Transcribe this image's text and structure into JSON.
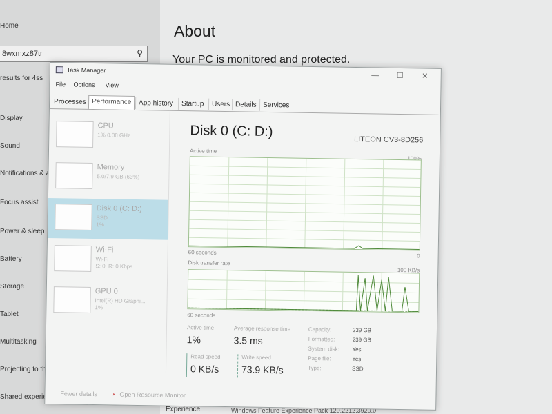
{
  "background": {
    "sidebar_items": [
      "Home",
      "Display",
      "Sound",
      "Notifications & actions",
      "Focus assist",
      "Power & sleep",
      "Battery",
      "Storage",
      "Tablet",
      "Multitasking",
      "Projecting to this PC",
      "Shared experiences"
    ],
    "search_value": "8wxmxz87tr",
    "results_text": "results for 4ss",
    "about_title": "About",
    "about_subtitle": "Your PC is monitored and protected.",
    "bottom_link": "Experience",
    "bottom_text": "Windows Feature Experience Pack 120.2212.3920.0"
  },
  "task_manager": {
    "title": "Task Manager",
    "window_buttons": [
      "—",
      "☐",
      "✕"
    ],
    "menu": [
      "File",
      "Options",
      "View"
    ],
    "tabs": [
      "Processes",
      "Performance",
      "App history",
      "Startup",
      "Users",
      "Details",
      "Services"
    ],
    "active_tab": "Performance",
    "resources": [
      {
        "name": "CPU",
        "detail": "1% 0.88 GHz"
      },
      {
        "name": "Memory",
        "detail": "5.0/7.9 GB (63%)"
      },
      {
        "name": "Disk 0 (C: D:)",
        "detail": "SSD\n1%"
      },
      {
        "name": "Wi-Fi",
        "detail": "Wi-Fi\nS: 0  R: 0 Kbps"
      },
      {
        "name": "GPU 0",
        "detail": "Intel(R) HD Graphi...\n1%"
      }
    ],
    "disk": {
      "title": "Disk 0 (C: D:)",
      "model": "LITEON CV3-8D256",
      "active_time_label": "Active time",
      "active_time_max": "100%",
      "seconds_label_1": "60 seconds",
      "seconds_label_1_end": "0",
      "transfer_label": "Disk transfer rate",
      "transfer_max": "100 KB/s",
      "seconds_label_2": "60 seconds",
      "stats": {
        "active_time": {
          "label": "Active time",
          "value": "1%"
        },
        "avg_response": {
          "label": "Average response time",
          "value": "3.5 ms"
        },
        "read_speed": {
          "label": "Read speed",
          "value": "0 KB/s"
        },
        "write_speed": {
          "label": "Write speed",
          "value": "73.9 KB/s"
        }
      },
      "properties": [
        {
          "label": "Capacity:",
          "value": "239 GB"
        },
        {
          "label": "Formatted:",
          "value": "239 GB"
        },
        {
          "label": "System disk:",
          "value": "Yes"
        },
        {
          "label": "Page file:",
          "value": "Yes"
        },
        {
          "label": "Type:",
          "value": "SSD"
        }
      ]
    },
    "footer": {
      "fewer_details": "Fewer details",
      "resource_monitor": "Open Resource Monitor"
    }
  },
  "colors": {
    "graph_border": "#9ec08f",
    "graph_line": "#4f8a3a",
    "selected_item": "#bcdde8"
  }
}
